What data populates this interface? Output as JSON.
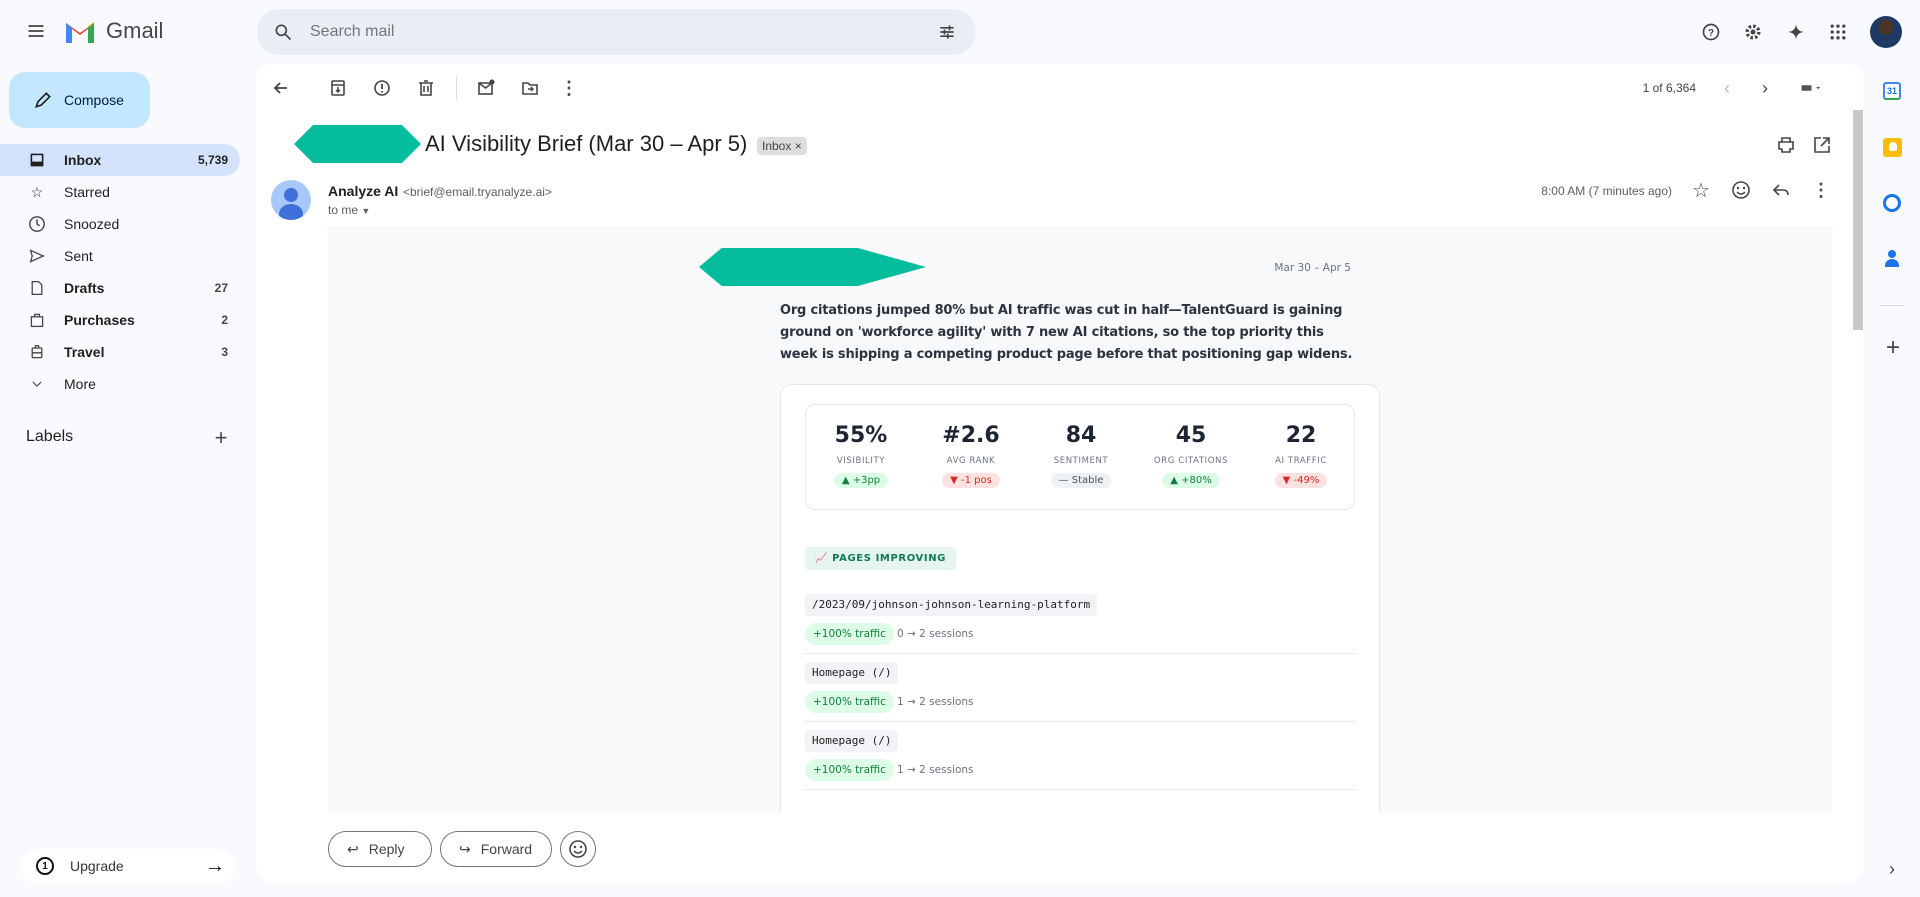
{
  "app": {
    "name": "Gmail"
  },
  "search": {
    "placeholder": "Search mail"
  },
  "compose": {
    "label": "Compose"
  },
  "sidebar": {
    "items": [
      {
        "label": "Inbox",
        "count": "5,739",
        "icon": "inbox-icon",
        "bold": true,
        "active": true
      },
      {
        "label": "Starred",
        "count": "",
        "icon": "star-icon"
      },
      {
        "label": "Snoozed",
        "count": "",
        "icon": "clock-icon"
      },
      {
        "label": "Sent",
        "count": "",
        "icon": "send-icon"
      },
      {
        "label": "Drafts",
        "count": "27",
        "icon": "draft-icon",
        "bold": true
      },
      {
        "label": "Purchases",
        "count": "2",
        "icon": "bag-icon",
        "bold": true
      },
      {
        "label": "Travel",
        "count": "3",
        "icon": "suitcase-icon",
        "bold": true
      },
      {
        "label": "More",
        "count": "",
        "icon": "chevron-down-icon"
      }
    ],
    "labels_heading": "Labels",
    "upgrade": "Upgrade"
  },
  "toolbar": {
    "pagination": "1 of 6,364"
  },
  "email": {
    "subject": "AI Visibility Brief (Mar 30 – Apr 5)",
    "label_chip": "Inbox",
    "label_close": "×",
    "sender_name": "Analyze AI",
    "sender_email": "<brief@email.tryanalyze.ai>",
    "to": "to me",
    "time": "8:00 AM (7 minutes ago)"
  },
  "brief": {
    "date_range": "Mar 30 – Apr 5",
    "summary": "Org citations jumped 80% but AI traffic was cut in half—TalentGuard is gaining ground on 'workforce agility' with 7 new AI citations, so the top priority this week is shipping a competing product page before that positioning gap widens.",
    "stats": [
      {
        "value": "55%",
        "label": "VISIBILITY",
        "change": "▲ +3pp",
        "trend": "up"
      },
      {
        "value": "#2.6",
        "label": "AVG RANK",
        "change": "▼ -1 pos",
        "trend": "down"
      },
      {
        "value": "84",
        "label": "SENTIMENT",
        "change": "— Stable",
        "trend": "neutral"
      },
      {
        "value": "45",
        "label": "ORG CITATIONS",
        "change": "▲ +80%",
        "trend": "up"
      },
      {
        "value": "22",
        "label": "AI TRAFFIC",
        "change": "▼ -49%",
        "trend": "down"
      }
    ],
    "section_title": "📈 PAGES IMPROVING",
    "pages": [
      {
        "path": "/2023/09/johnson-johnson-learning-platform",
        "change": "+100% traffic",
        "sessions": "0 → 2 sessions"
      },
      {
        "path": "Homepage (/)",
        "change": "+100% traffic",
        "sessions": "1 → 2 sessions"
      },
      {
        "path": "Homepage (/)",
        "change": "+100% traffic",
        "sessions": "1 → 2 sessions"
      }
    ]
  },
  "actions": {
    "reply": "Reply",
    "forward": "Forward"
  },
  "colors": {
    "accent": "#0b57d0",
    "redaction": "#05bc9c",
    "compose_bg": "#c2e7ff",
    "active_nav": "#d3e3fd"
  }
}
